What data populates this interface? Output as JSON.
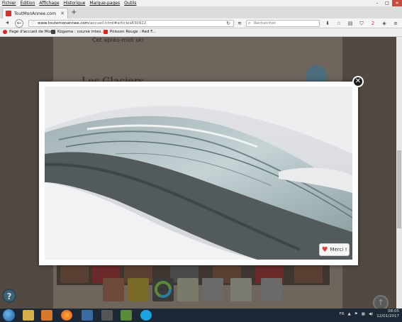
{
  "menu": [
    "Fichier",
    "Édition",
    "Affichage",
    "Historique",
    "Marque-pages",
    "Outils"
  ],
  "window_controls": {
    "minimize": "–",
    "maximize": "□",
    "close": "✕"
  },
  "tab": {
    "title": "ToutMonAnnee.com",
    "close": "✕",
    "new_tab": "+"
  },
  "nav": {
    "url_host": "www.toutemonannee.com",
    "url_path": "/accueil.html#articles830922",
    "search_placeholder": "Rechercher",
    "notification_count": "2"
  },
  "bookmarks": [
    {
      "label": "Page d'accueil de Moc...",
      "color": "#d22"
    },
    {
      "label": "Kogama : course intes...",
      "color": "#444"
    },
    {
      "label": "Poisson Rouge : Red F...",
      "color": "#d22"
    }
  ],
  "page": {
    "subtitle": "Cet après-midi ski",
    "title": "Les Glaciers"
  },
  "lightbox": {
    "close_glyph": "✕",
    "merci_label": "Merci !",
    "heart": "♥"
  },
  "help_glyph": "?",
  "up_glyph": "↑",
  "taskbar": {
    "lang": "FR",
    "time": "08:05",
    "date": "12/01/2017"
  },
  "colors": {
    "accent_red": "#e23e3e",
    "taskbar": "#1d2836"
  }
}
